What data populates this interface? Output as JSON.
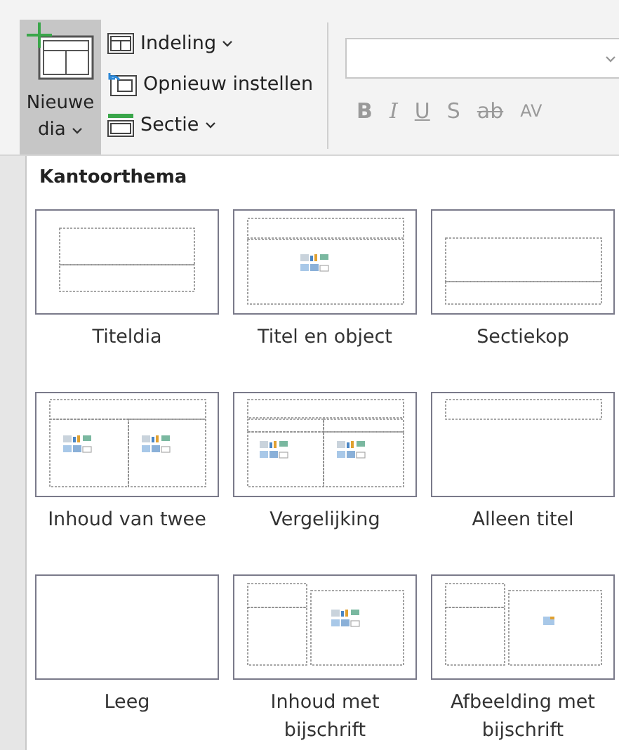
{
  "ribbon": {
    "new_slide": {
      "label": "Nieuwe dia",
      "selected": true
    },
    "commands": [
      {
        "kind": "layout",
        "label": "Indeling",
        "has_menu": true
      },
      {
        "kind": "reset",
        "label": "Opnieuw instellen",
        "has_menu": false
      },
      {
        "kind": "section",
        "label": "Sectie",
        "has_menu": true
      }
    ],
    "format_buttons": [
      {
        "kind": "bold",
        "label": "B",
        "disabled": true
      },
      {
        "kind": "italic",
        "label": "I",
        "disabled": true
      },
      {
        "kind": "underline",
        "label": "U",
        "disabled": true
      },
      {
        "kind": "shadow",
        "label": "S",
        "disabled": true
      },
      {
        "kind": "strike",
        "label": "ab",
        "disabled": true
      },
      {
        "kind": "spacing",
        "label": "AV",
        "disabled": true
      }
    ]
  },
  "gallery": {
    "heading": "Kantoorthema",
    "layouts": [
      {
        "kind": "title",
        "label": "Titeldia"
      },
      {
        "kind": "title-content",
        "label": "Titel en object"
      },
      {
        "kind": "section",
        "label": "Sectiekop"
      },
      {
        "kind": "two-content",
        "label": "Inhoud van twee"
      },
      {
        "kind": "comparison",
        "label": "Vergelijking"
      },
      {
        "kind": "title-only",
        "label": "Alleen titel"
      },
      {
        "kind": "blank",
        "label": "Leeg"
      },
      {
        "kind": "content-caption",
        "label": "Inhoud met bijschrift"
      },
      {
        "kind": "picture-caption",
        "label": "Afbeelding met bijschrift"
      }
    ]
  }
}
